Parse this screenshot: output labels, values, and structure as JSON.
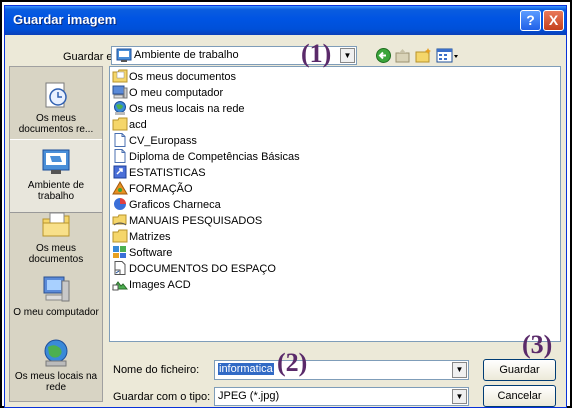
{
  "window": {
    "title": "Guardar imagem",
    "help_glyph": "?",
    "close_glyph": "X"
  },
  "toolbar": {
    "save_in_label": "Guardar em:",
    "save_in_value": "Ambiente de trabalho",
    "tools": [
      "back-icon",
      "up-folder-icon",
      "new-folder-icon",
      "view-menu-icon"
    ]
  },
  "places": [
    {
      "label": "Os meus documentos re...",
      "icon": "recent-documents-icon"
    },
    {
      "label": "Ambiente de trabalho",
      "icon": "desktop-icon",
      "selected": true
    },
    {
      "label": "Os meus documentos",
      "icon": "my-documents-icon"
    },
    {
      "label": "O meu computador",
      "icon": "my-computer-icon"
    },
    {
      "label": "Os meus locais na rede",
      "icon": "network-places-icon"
    }
  ],
  "files": [
    {
      "name": "Os meus documentos",
      "icon": "folder-docs-icon"
    },
    {
      "name": "O meu computador",
      "icon": "computer-icon"
    },
    {
      "name": "Os meus locais na rede",
      "icon": "network-icon"
    },
    {
      "name": "acd",
      "icon": "folder-icon"
    },
    {
      "name": "CV_Europass",
      "icon": "document-icon"
    },
    {
      "name": "Diploma de Competências Básicas",
      "icon": "document-icon"
    },
    {
      "name": "ESTATISTICAS",
      "icon": "shortcut-icon"
    },
    {
      "name": "FORMAÇÃO",
      "icon": "media-icon"
    },
    {
      "name": "Graficos Charneca",
      "icon": "chart-icon"
    },
    {
      "name": "MANUAIS PESQUISADOS",
      "icon": "network-folder-icon"
    },
    {
      "name": "Matrizes",
      "icon": "folder-icon"
    },
    {
      "name": "Software",
      "icon": "software-icon"
    },
    {
      "name": "DOCUMENTOS DO ESPAÇO",
      "icon": "document-shortcut-icon"
    },
    {
      "name": "Images ACD",
      "icon": "images-shortcut-icon"
    }
  ],
  "form": {
    "filename_label": "Nome do ficheiro:",
    "filename_value": "informatica",
    "filetype_label": "Guardar com o tipo:",
    "filetype_value": "JPEG (*.jpg)",
    "save_button": "Guardar",
    "cancel_button": "Cancelar"
  },
  "annotations": [
    "(1)",
    "(2)",
    "(3)"
  ],
  "colors": {
    "titlebar": "#0054e3",
    "selection": "#316ac5",
    "dialog_bg": "#ece9d8",
    "annotation": "#5a2a6a"
  }
}
